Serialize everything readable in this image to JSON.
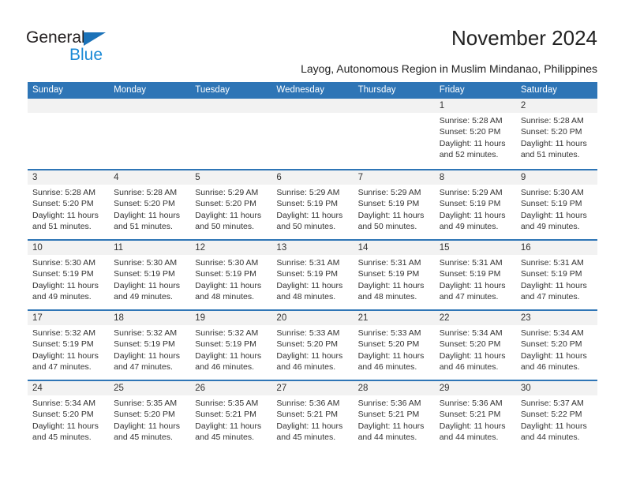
{
  "brand": {
    "name_part1": "General",
    "name_part2": "Blue",
    "triangle_icon": "blue-triangle-icon",
    "accent_color": "#2e75b6",
    "logo_blue": "#1b8ad6"
  },
  "header": {
    "title": "November 2024",
    "subtitle": "Layog, Autonomous Region in Muslim Mindanao, Philippines"
  },
  "calendar": {
    "weekdays": [
      "Sunday",
      "Monday",
      "Tuesday",
      "Wednesday",
      "Thursday",
      "Friday",
      "Saturday"
    ],
    "weeks": [
      [
        {
          "day": "",
          "sunrise": "",
          "sunset": "",
          "daylight": ""
        },
        {
          "day": "",
          "sunrise": "",
          "sunset": "",
          "daylight": ""
        },
        {
          "day": "",
          "sunrise": "",
          "sunset": "",
          "daylight": ""
        },
        {
          "day": "",
          "sunrise": "",
          "sunset": "",
          "daylight": ""
        },
        {
          "day": "",
          "sunrise": "",
          "sunset": "",
          "daylight": ""
        },
        {
          "day": "1",
          "sunrise": "Sunrise: 5:28 AM",
          "sunset": "Sunset: 5:20 PM",
          "daylight": "Daylight: 11 hours and 52 minutes."
        },
        {
          "day": "2",
          "sunrise": "Sunrise: 5:28 AM",
          "sunset": "Sunset: 5:20 PM",
          "daylight": "Daylight: 11 hours and 51 minutes."
        }
      ],
      [
        {
          "day": "3",
          "sunrise": "Sunrise: 5:28 AM",
          "sunset": "Sunset: 5:20 PM",
          "daylight": "Daylight: 11 hours and 51 minutes."
        },
        {
          "day": "4",
          "sunrise": "Sunrise: 5:28 AM",
          "sunset": "Sunset: 5:20 PM",
          "daylight": "Daylight: 11 hours and 51 minutes."
        },
        {
          "day": "5",
          "sunrise": "Sunrise: 5:29 AM",
          "sunset": "Sunset: 5:20 PM",
          "daylight": "Daylight: 11 hours and 50 minutes."
        },
        {
          "day": "6",
          "sunrise": "Sunrise: 5:29 AM",
          "sunset": "Sunset: 5:19 PM",
          "daylight": "Daylight: 11 hours and 50 minutes."
        },
        {
          "day": "7",
          "sunrise": "Sunrise: 5:29 AM",
          "sunset": "Sunset: 5:19 PM",
          "daylight": "Daylight: 11 hours and 50 minutes."
        },
        {
          "day": "8",
          "sunrise": "Sunrise: 5:29 AM",
          "sunset": "Sunset: 5:19 PM",
          "daylight": "Daylight: 11 hours and 49 minutes."
        },
        {
          "day": "9",
          "sunrise": "Sunrise: 5:30 AM",
          "sunset": "Sunset: 5:19 PM",
          "daylight": "Daylight: 11 hours and 49 minutes."
        }
      ],
      [
        {
          "day": "10",
          "sunrise": "Sunrise: 5:30 AM",
          "sunset": "Sunset: 5:19 PM",
          "daylight": "Daylight: 11 hours and 49 minutes."
        },
        {
          "day": "11",
          "sunrise": "Sunrise: 5:30 AM",
          "sunset": "Sunset: 5:19 PM",
          "daylight": "Daylight: 11 hours and 49 minutes."
        },
        {
          "day": "12",
          "sunrise": "Sunrise: 5:30 AM",
          "sunset": "Sunset: 5:19 PM",
          "daylight": "Daylight: 11 hours and 48 minutes."
        },
        {
          "day": "13",
          "sunrise": "Sunrise: 5:31 AM",
          "sunset": "Sunset: 5:19 PM",
          "daylight": "Daylight: 11 hours and 48 minutes."
        },
        {
          "day": "14",
          "sunrise": "Sunrise: 5:31 AM",
          "sunset": "Sunset: 5:19 PM",
          "daylight": "Daylight: 11 hours and 48 minutes."
        },
        {
          "day": "15",
          "sunrise": "Sunrise: 5:31 AM",
          "sunset": "Sunset: 5:19 PM",
          "daylight": "Daylight: 11 hours and 47 minutes."
        },
        {
          "day": "16",
          "sunrise": "Sunrise: 5:31 AM",
          "sunset": "Sunset: 5:19 PM",
          "daylight": "Daylight: 11 hours and 47 minutes."
        }
      ],
      [
        {
          "day": "17",
          "sunrise": "Sunrise: 5:32 AM",
          "sunset": "Sunset: 5:19 PM",
          "daylight": "Daylight: 11 hours and 47 minutes."
        },
        {
          "day": "18",
          "sunrise": "Sunrise: 5:32 AM",
          "sunset": "Sunset: 5:19 PM",
          "daylight": "Daylight: 11 hours and 47 minutes."
        },
        {
          "day": "19",
          "sunrise": "Sunrise: 5:32 AM",
          "sunset": "Sunset: 5:19 PM",
          "daylight": "Daylight: 11 hours and 46 minutes."
        },
        {
          "day": "20",
          "sunrise": "Sunrise: 5:33 AM",
          "sunset": "Sunset: 5:20 PM",
          "daylight": "Daylight: 11 hours and 46 minutes."
        },
        {
          "day": "21",
          "sunrise": "Sunrise: 5:33 AM",
          "sunset": "Sunset: 5:20 PM",
          "daylight": "Daylight: 11 hours and 46 minutes."
        },
        {
          "day": "22",
          "sunrise": "Sunrise: 5:34 AM",
          "sunset": "Sunset: 5:20 PM",
          "daylight": "Daylight: 11 hours and 46 minutes."
        },
        {
          "day": "23",
          "sunrise": "Sunrise: 5:34 AM",
          "sunset": "Sunset: 5:20 PM",
          "daylight": "Daylight: 11 hours and 46 minutes."
        }
      ],
      [
        {
          "day": "24",
          "sunrise": "Sunrise: 5:34 AM",
          "sunset": "Sunset: 5:20 PM",
          "daylight": "Daylight: 11 hours and 45 minutes."
        },
        {
          "day": "25",
          "sunrise": "Sunrise: 5:35 AM",
          "sunset": "Sunset: 5:20 PM",
          "daylight": "Daylight: 11 hours and 45 minutes."
        },
        {
          "day": "26",
          "sunrise": "Sunrise: 5:35 AM",
          "sunset": "Sunset: 5:21 PM",
          "daylight": "Daylight: 11 hours and 45 minutes."
        },
        {
          "day": "27",
          "sunrise": "Sunrise: 5:36 AM",
          "sunset": "Sunset: 5:21 PM",
          "daylight": "Daylight: 11 hours and 45 minutes."
        },
        {
          "day": "28",
          "sunrise": "Sunrise: 5:36 AM",
          "sunset": "Sunset: 5:21 PM",
          "daylight": "Daylight: 11 hours and 44 minutes."
        },
        {
          "day": "29",
          "sunrise": "Sunrise: 5:36 AM",
          "sunset": "Sunset: 5:21 PM",
          "daylight": "Daylight: 11 hours and 44 minutes."
        },
        {
          "day": "30",
          "sunrise": "Sunrise: 5:37 AM",
          "sunset": "Sunset: 5:22 PM",
          "daylight": "Daylight: 11 hours and 44 minutes."
        }
      ]
    ]
  }
}
